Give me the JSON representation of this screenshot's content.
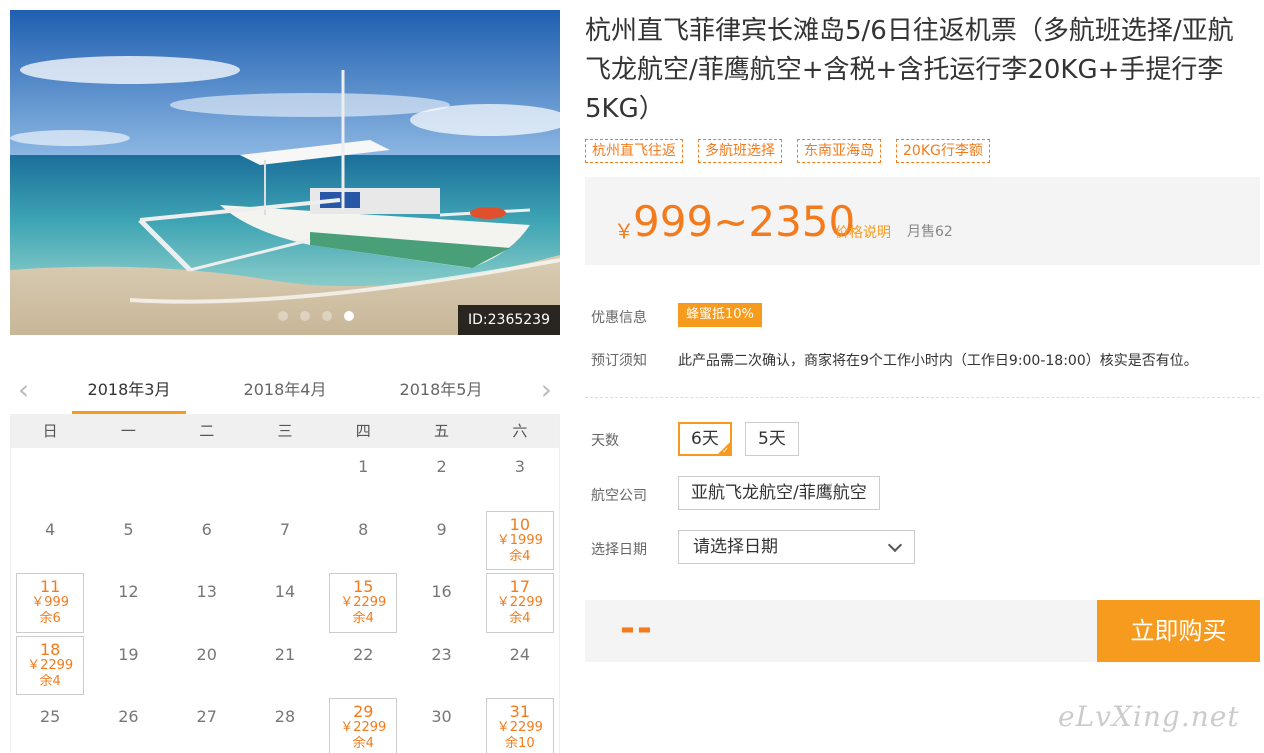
{
  "photo": {
    "id_label": "ID:2365239",
    "dots": 4,
    "active_dot": 3
  },
  "calendar": {
    "months": [
      "2018年3月",
      "2018年4月",
      "2018年5月"
    ],
    "active_month": 0,
    "weekdays": [
      "日",
      "一",
      "二",
      "三",
      "四",
      "五",
      "六"
    ],
    "weeks": [
      [
        null,
        null,
        null,
        null,
        {
          "d": "1"
        },
        {
          "d": "2"
        },
        {
          "d": "3"
        }
      ],
      [
        {
          "d": "4"
        },
        {
          "d": "5"
        },
        {
          "d": "6"
        },
        {
          "d": "7"
        },
        {
          "d": "8"
        },
        {
          "d": "9"
        },
        {
          "d": "10",
          "price": "￥1999",
          "stock": "余4"
        }
      ],
      [
        {
          "d": "11",
          "price": "￥999",
          "stock": "余6"
        },
        {
          "d": "12"
        },
        {
          "d": "13"
        },
        {
          "d": "14"
        },
        {
          "d": "15",
          "price": "￥2299",
          "stock": "余4"
        },
        {
          "d": "16"
        },
        {
          "d": "17",
          "price": "￥2299",
          "stock": "余4"
        }
      ],
      [
        {
          "d": "18",
          "price": "￥2299",
          "stock": "余4"
        },
        {
          "d": "19"
        },
        {
          "d": "20"
        },
        {
          "d": "21"
        },
        {
          "d": "22"
        },
        {
          "d": "23"
        },
        {
          "d": "24"
        }
      ],
      [
        {
          "d": "25"
        },
        {
          "d": "26"
        },
        {
          "d": "27"
        },
        {
          "d": "28"
        },
        {
          "d": "29",
          "price": "￥2299",
          "stock": "余4"
        },
        {
          "d": "30"
        },
        {
          "d": "31",
          "price": "￥2299",
          "stock": "余10"
        }
      ]
    ]
  },
  "product": {
    "title": "杭州直飞菲律宾长滩岛5/6日往返机票（多航班选择/亚航飞龙航空/菲鹰航空+含税+含托运行李20KG+手提行李5KG）",
    "tags": [
      "杭州直飞往返",
      "多航班选择",
      "东南亚海岛",
      "20KG行李额"
    ],
    "price_symbol": "￥",
    "price_range": "999~2350",
    "price_explain": "价格说明",
    "monthly_sales": "月售62",
    "promo_label": "优惠信息",
    "promo_badge": "蜂蜜抵10%",
    "notice_label": "预订须知",
    "notice_text": "此产品需二次确认，商家将在9个工作小时内（工作日9:00-18:00）核实是否有位。",
    "days_label": "天数",
    "day_options": [
      "6天",
      "5天"
    ],
    "airline_label": "航空公司",
    "airline_option": "亚航飞龙航空/菲鹰航空",
    "date_label": "选择日期",
    "date_placeholder": "请选择日期",
    "total": "--",
    "buy_label": "立即购买"
  },
  "watermark": "eLvXing.net",
  "colors": {
    "accent": "#f79b1e",
    "price": "#f37b1d",
    "panel": "#f4f4f4"
  }
}
